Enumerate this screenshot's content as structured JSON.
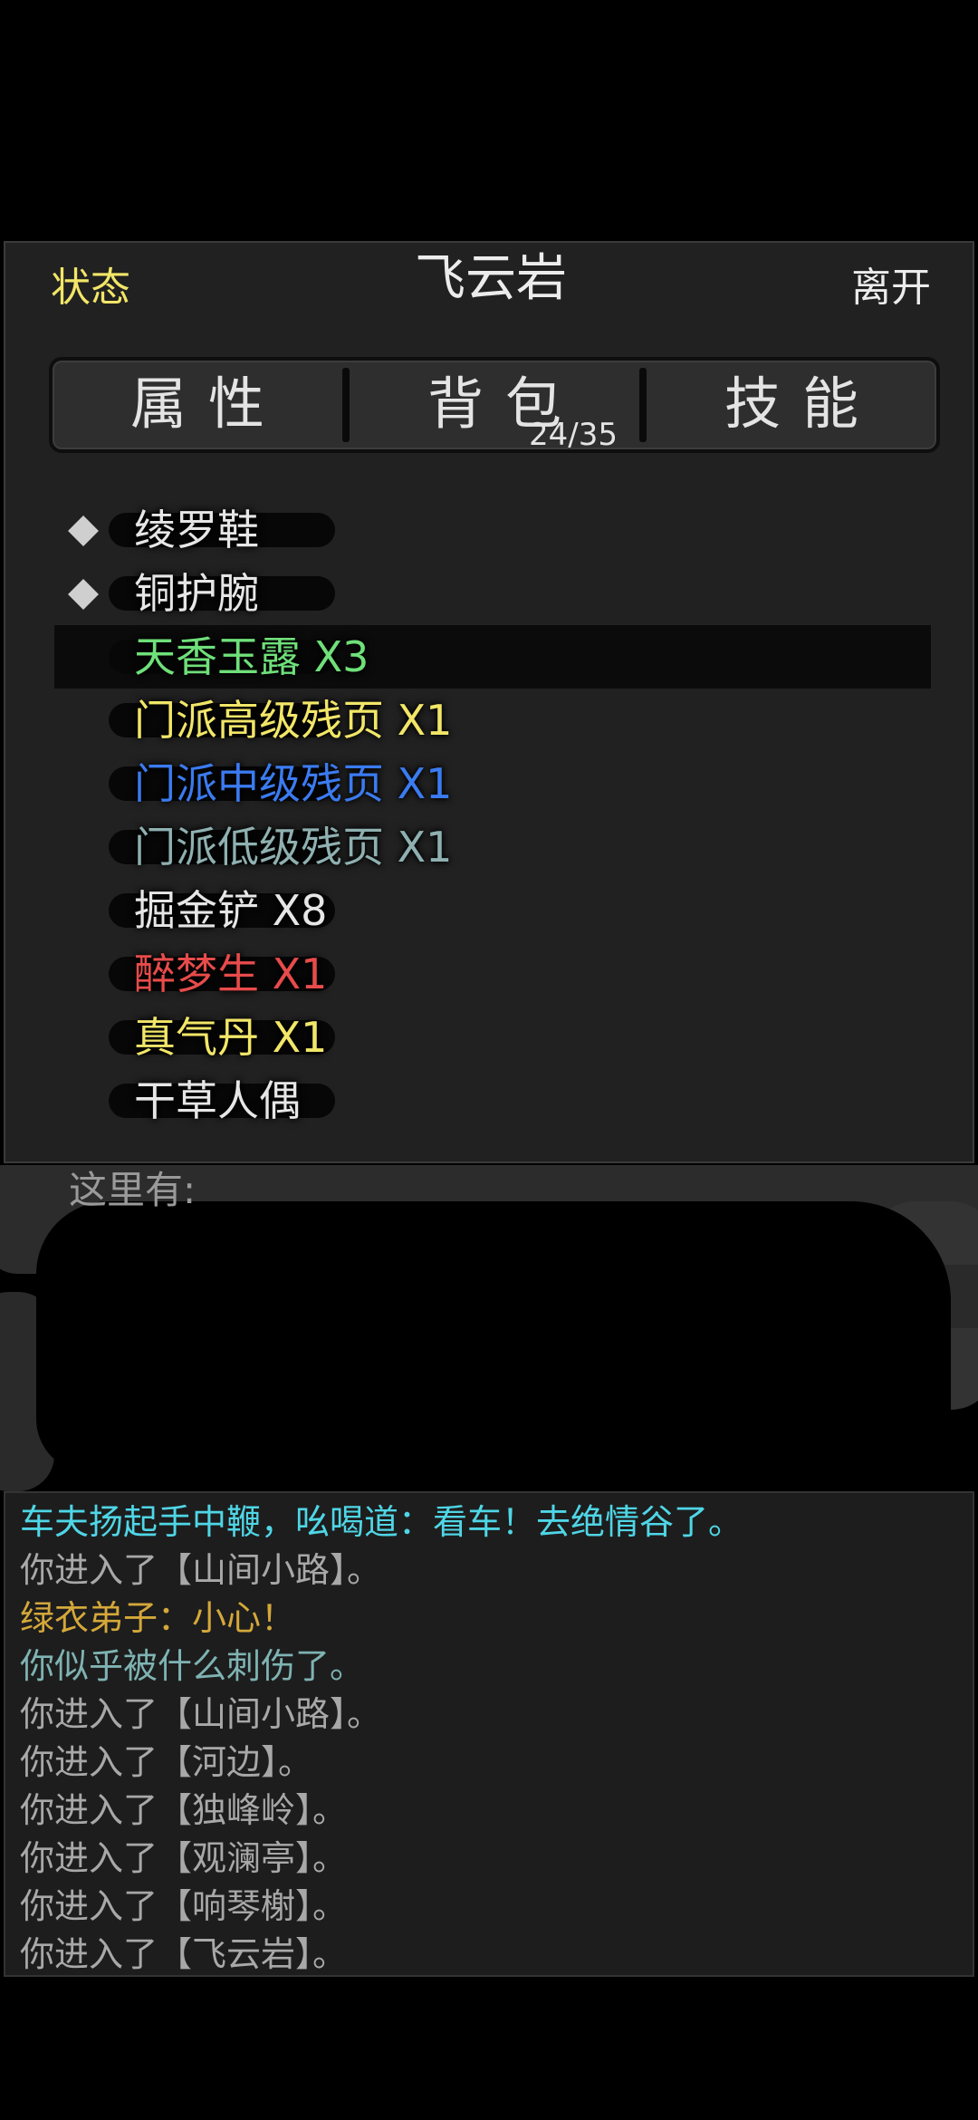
{
  "header": {
    "status_label": "状态",
    "title": "飞云岩",
    "leave_label": "离开"
  },
  "tabs": {
    "attributes": "属性",
    "bag": "背包",
    "bag_count": "24/35",
    "skills": "技能"
  },
  "inventory": [
    {
      "name": "绫罗鞋",
      "color": "#e6e6e6",
      "equipped": true
    },
    {
      "name": "铜护腕",
      "color": "#e6e6e6",
      "equipped": true
    },
    {
      "name": "天香玉露 X3",
      "color": "#6fe07a",
      "selected": true
    },
    {
      "name": "门派高级残页 X1",
      "color": "#f2e668"
    },
    {
      "name": "门派中级残页 X1",
      "color": "#3b7bf0"
    },
    {
      "name": "门派低级残页 X1",
      "color": "#8fb0b0"
    },
    {
      "name": "掘金铲 X8",
      "color": "#e6e6e6"
    },
    {
      "name": "醉梦生 X1",
      "color": "#e84b4b"
    },
    {
      "name": "真气丹 X1",
      "color": "#f2e668"
    },
    {
      "name": "干草人偶",
      "color": "#e6e6e6"
    }
  ],
  "room": {
    "here_label": "这里有:"
  },
  "log": [
    {
      "text": "车夫扬起手中鞭，吆喝道：看车！去绝情谷了。",
      "color": "#4fd6e6"
    },
    {
      "text": "你进入了【山间小路】。",
      "color": "#a8a8a8"
    },
    {
      "text": "绿衣弟子：小心！",
      "color": "#d4a83a"
    },
    {
      "text": "你似乎被什么刺伤了。",
      "color": "#7fb3b3"
    },
    {
      "text": "你进入了【山间小路】。",
      "color": "#a8a8a8"
    },
    {
      "text": "你进入了【河边】。",
      "color": "#a8a8a8"
    },
    {
      "text": "你进入了【独峰岭】。",
      "color": "#a8a8a8"
    },
    {
      "text": "你进入了【观澜亭】。",
      "color": "#a8a8a8"
    },
    {
      "text": "你进入了【响琴榭】。",
      "color": "#a8a8a8"
    },
    {
      "text": "你进入了【飞云岩】。",
      "color": "#a8a8a8"
    }
  ]
}
